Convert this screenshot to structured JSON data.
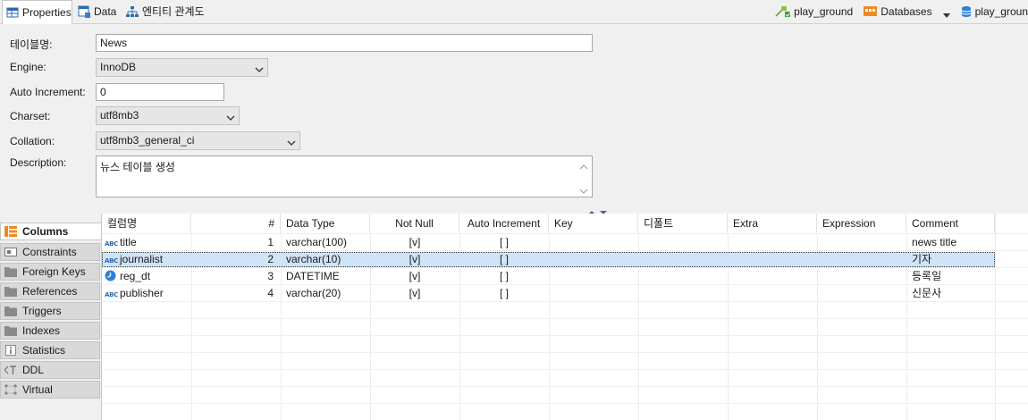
{
  "tabs": [
    {
      "label": "Properties",
      "icon": "properties-icon"
    },
    {
      "label": "Data",
      "icon": "data-icon"
    },
    {
      "label": "엔티티 관계도",
      "icon": "er-diagram-icon"
    }
  ],
  "breadcrumbs": [
    {
      "label": "play_ground",
      "icon": "connection-icon"
    },
    {
      "label": "Databases",
      "icon": "databases-folder-icon",
      "dropdown": true
    },
    {
      "label": "play_groun",
      "icon": "database-icon"
    }
  ],
  "form": {
    "table_name_label": "테이블명:",
    "table_name_value": "News",
    "engine_label": "Engine:",
    "engine_value": "InnoDB",
    "auto_increment_label": "Auto Increment:",
    "auto_increment_value": "0",
    "charset_label": "Charset:",
    "charset_value": "utf8mb3",
    "collation_label": "Collation:",
    "collation_value": "utf8mb3_general_ci",
    "description_label": "Description:",
    "description_value": "뉴스 테이블 생성"
  },
  "side_tabs": [
    {
      "label": "Columns",
      "active": true
    },
    {
      "label": "Constraints"
    },
    {
      "label": "Foreign Keys"
    },
    {
      "label": "References"
    },
    {
      "label": "Triggers"
    },
    {
      "label": "Indexes"
    },
    {
      "label": "Statistics"
    },
    {
      "label": "DDL"
    },
    {
      "label": "Virtual"
    }
  ],
  "grid": {
    "columns": [
      "컬럼명",
      "#",
      "Data Type",
      "Not Null",
      "Auto Increment",
      "Key",
      "디폴트",
      "Extra",
      "Expression",
      "Comment"
    ],
    "rows": [
      {
        "icon": "abc",
        "name": "title",
        "num": "1",
        "type": "varchar(100)",
        "not_null": "[v]",
        "auto_inc": "[ ]",
        "key": "",
        "default": "",
        "extra": "",
        "expression": "",
        "comment": "news title"
      },
      {
        "icon": "abc",
        "name": "journalist",
        "num": "2",
        "type": "varchar(10)",
        "not_null": "[v]",
        "auto_inc": "[ ]",
        "key": "",
        "default": "",
        "extra": "",
        "expression": "",
        "comment": "기자",
        "selected": true
      },
      {
        "icon": "clock",
        "name": "reg_dt",
        "num": "3",
        "type": "DATETIME",
        "not_null": "[v]",
        "auto_inc": "[ ]",
        "key": "",
        "default": "",
        "extra": "",
        "expression": "",
        "comment": "등록일"
      },
      {
        "icon": "abc",
        "name": "publisher",
        "num": "4",
        "type": "varchar(20)",
        "not_null": "[v]",
        "auto_inc": "[ ]",
        "key": "",
        "default": "",
        "extra": "",
        "expression": "",
        "comment": "신문사"
      }
    ],
    "abc_glyph": "ABC"
  },
  "colors": {
    "accent": "#2b6cb0",
    "selection": "#cfe4f7",
    "orange_icon": "#f08a24"
  }
}
